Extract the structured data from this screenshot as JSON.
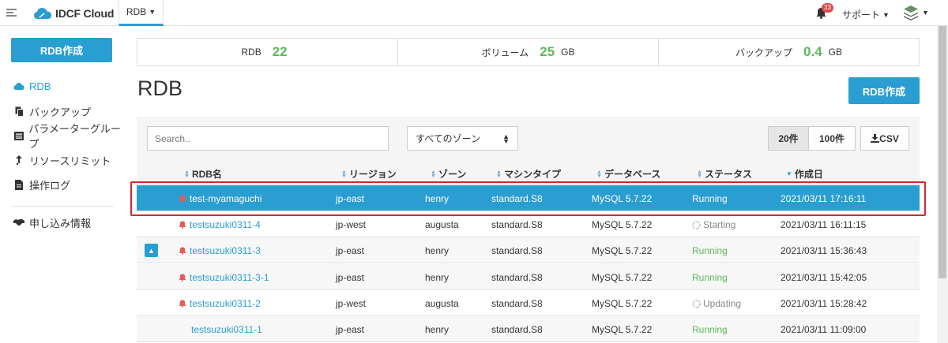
{
  "header": {
    "brand": "IDCF Cloud",
    "nav_label": "RDB",
    "notification_count": "33",
    "support_label": "サポート"
  },
  "sidebar": {
    "create_button": "RDB作成",
    "items": [
      {
        "label": "RDB",
        "icon": "cloud-icon"
      },
      {
        "label": "バックアップ",
        "icon": "copy-icon"
      },
      {
        "label": "パラメーターグループ",
        "icon": "list-icon"
      },
      {
        "label": "リソースリミット",
        "icon": "arrow-up-icon"
      },
      {
        "label": "操作ログ",
        "icon": "file-icon"
      },
      {
        "label": "申し込み情報",
        "icon": "handshake-icon"
      }
    ]
  },
  "summary": {
    "rdb_label": "RDB",
    "rdb_value": "22",
    "volume_label": "ボリューム",
    "volume_value": "25",
    "volume_unit": "GB",
    "backup_label": "バックアップ",
    "backup_value": "0.4",
    "backup_unit": "GB"
  },
  "page": {
    "title": "RDB",
    "create_button": "RDB作成"
  },
  "toolbar": {
    "search_placeholder": "Search..",
    "zone_select": "すべてのゾーン",
    "page_size_20": "20件",
    "page_size_100": "100件",
    "csv": "CSV"
  },
  "table": {
    "headers": {
      "name": "RDB名",
      "region": "リージョン",
      "zone": "ゾーン",
      "machine": "マシンタイプ",
      "db": "データベース",
      "status": "ステータス",
      "created": "作成日"
    },
    "rows": [
      {
        "name": "test-myamaguchi",
        "region": "jp-east",
        "zone": "henry",
        "machine": "standard.S8",
        "db": "MySQL 5.7.22",
        "status": "Running",
        "created": "2021/03/11 17:16:11"
      },
      {
        "name": "testsuzuki0311-4",
        "region": "jp-west",
        "zone": "augusta",
        "machine": "standard.S8",
        "db": "MySQL 5.7.22",
        "status": "Starting",
        "created": "2021/03/11 16:11:15"
      },
      {
        "name": "testsuzuki0311-3",
        "region": "jp-east",
        "zone": "henry",
        "machine": "standard.S8",
        "db": "MySQL 5.7.22",
        "status": "Running",
        "created": "2021/03/11 15:36:43"
      },
      {
        "name": "testsuzuki0311-3-1",
        "region": "jp-east",
        "zone": "henry",
        "machine": "standard.S8",
        "db": "MySQL 5.7.22",
        "status": "Running",
        "created": "2021/03/11 15:42:05"
      },
      {
        "name": "testsuzuki0311-2",
        "region": "jp-west",
        "zone": "augusta",
        "machine": "standard.S8",
        "db": "MySQL 5.7.22",
        "status": "Updating",
        "created": "2021/03/11 15:28:42"
      },
      {
        "name": "testsuzuki0311-1",
        "region": "jp-east",
        "zone": "henry",
        "machine": "standard.S8",
        "db": "MySQL 5.7.22",
        "status": "Running",
        "created": "2021/03/11 11:09:00"
      }
    ]
  },
  "colors": {
    "accent": "#2b9ed1",
    "running": "#5cb85c",
    "highlight": "#d9262c"
  }
}
